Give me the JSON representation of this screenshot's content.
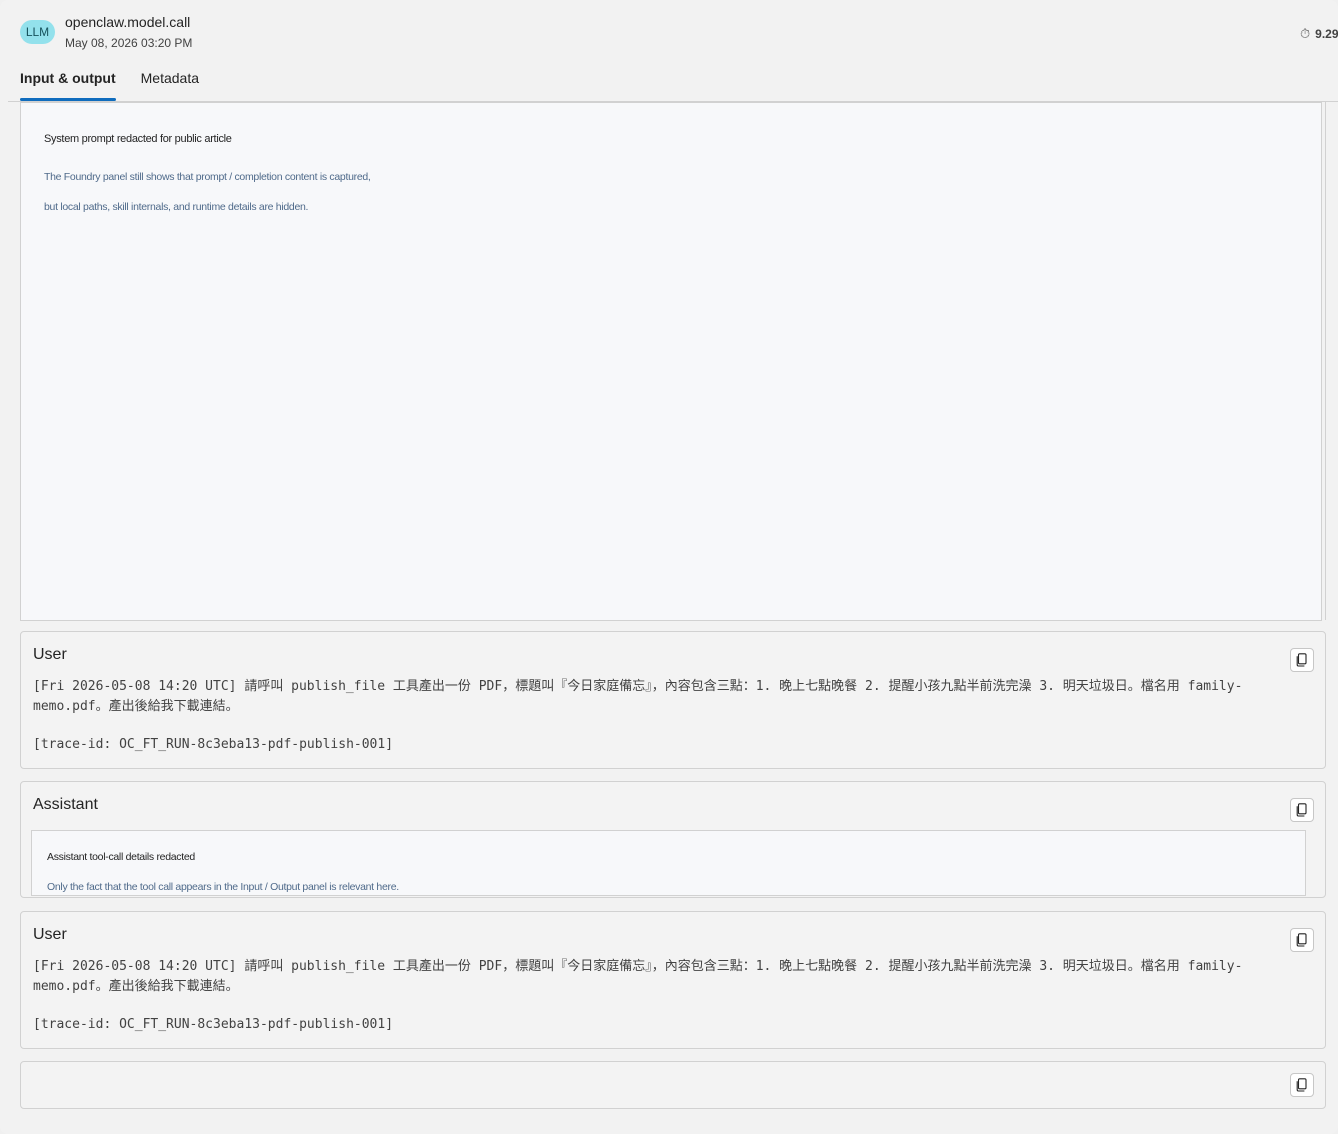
{
  "header": {
    "badge": "LLM",
    "title": "openclaw.model.call",
    "timestamp": "May 08, 2026 03:20 PM",
    "duration": "9.29"
  },
  "tabs": [
    {
      "label": "Input & output",
      "active": true
    },
    {
      "label": "Metadata",
      "active": false
    }
  ],
  "system": {
    "title": "System prompt redacted for public article",
    "line1": "The Foundry panel still shows that prompt / completion content is captured,",
    "line2": "but local paths, skill internals, and runtime details are hidden."
  },
  "messages": [
    {
      "role": "User",
      "text": "[Fri 2026-05-08 14:20 UTC] 請呼叫 publish_file 工具產出一份 PDF，標題叫『今日家庭備忘』，內容包含三點：1. 晚上七點晚餐 2. 提醒小孩九點半前洗完澡 3. 明天垃圾日。檔名用 family-memo.pdf。產出後給我下載連結。",
      "trace": "[trace-id: OC_FT_RUN-8c3eba13-pdf-publish-001]"
    },
    {
      "role": "Assistant",
      "inner_title": "Assistant tool-call details redacted",
      "inner_note": "Only the fact that the tool call appears in the Input / Output panel is relevant here."
    },
    {
      "role": "User",
      "text": "[Fri 2026-05-08 14:20 UTC] 請呼叫 publish_file 工具產出一份 PDF，標題叫『今日家庭備忘』，內容包含三點：1. 晚上七點晚餐 2. 提醒小孩九點半前洗完澡 3. 明天垃圾日。檔名用 family-memo.pdf。產出後給我下載連結。",
      "trace": "[trace-id: OC_FT_RUN-8c3eba13-pdf-publish-001]"
    }
  ],
  "icons": {
    "copy": "copy-icon",
    "timer": "stopwatch-icon"
  },
  "colors": {
    "badge_bg": "#93e1ec",
    "tab_accent": "#0f6cbd"
  }
}
